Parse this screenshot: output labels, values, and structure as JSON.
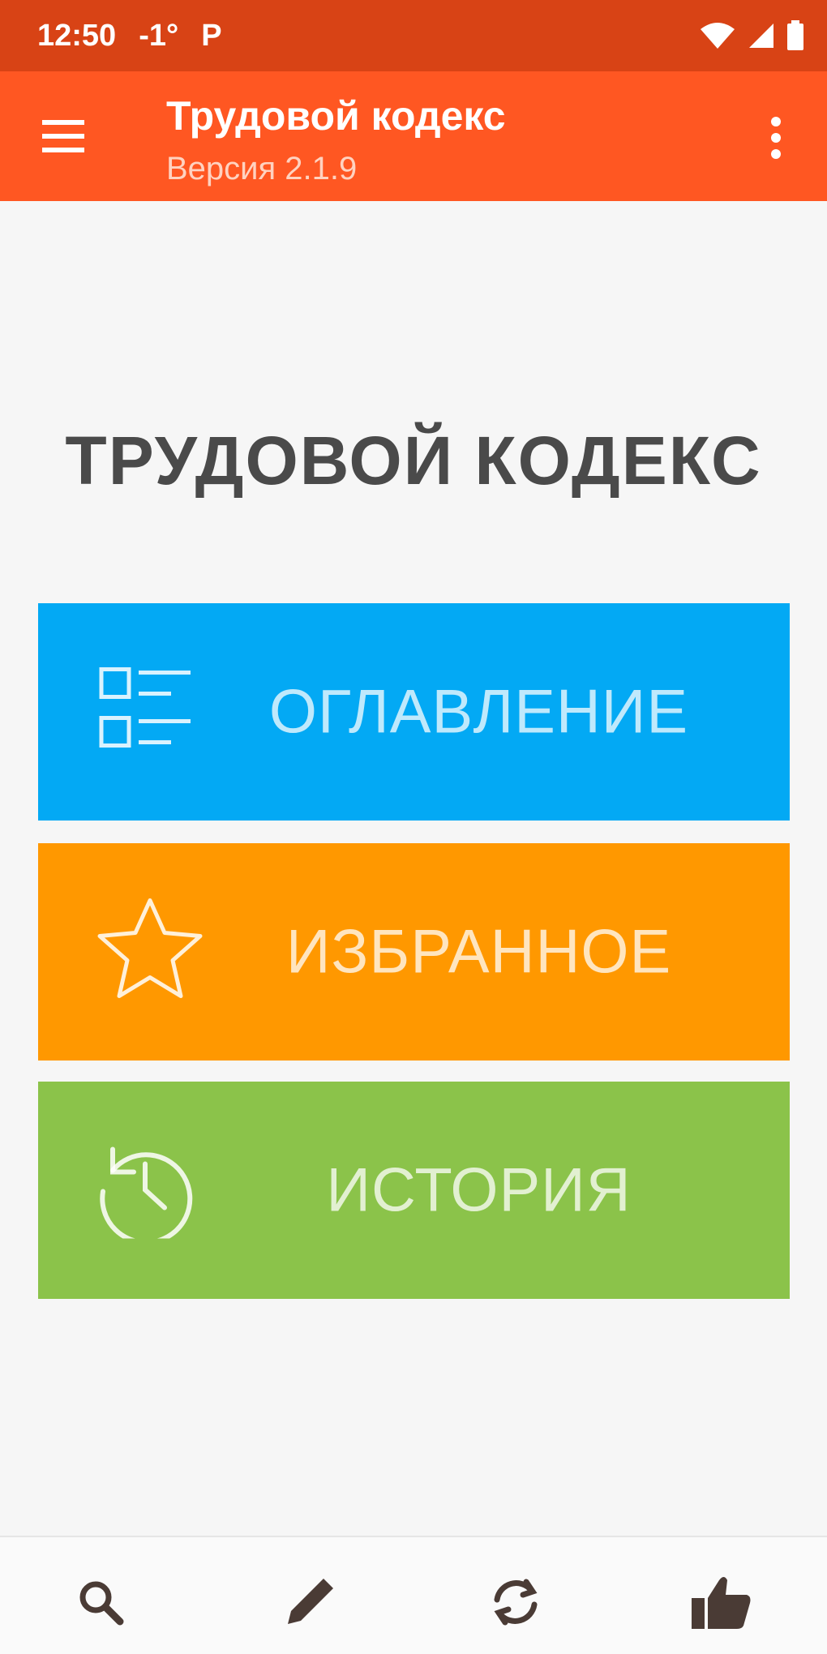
{
  "status_bar": {
    "time": "12:50",
    "temperature": "-1°",
    "notification": "P",
    "battery_label": "battery"
  },
  "app_bar": {
    "title": "Трудовой кодекс",
    "subtitle": "Версия 2.1.9",
    "menu_icon": "menu-icon",
    "overflow_icon": "more-vert-icon"
  },
  "main": {
    "heading": "ТРУДОВОЙ КОДЕКС",
    "tiles": [
      {
        "label": "ОГЛАВЛЕНИЕ",
        "icon": "list-icon",
        "color": "#03a9f4"
      },
      {
        "label": "ИЗБРАННОЕ",
        "icon": "star-icon",
        "color": "#ff9800"
      },
      {
        "label": "ИСТОРИЯ",
        "icon": "history-icon",
        "color": "#8bc34a"
      }
    ]
  },
  "bottom_bar": {
    "items": [
      {
        "icon": "search-icon"
      },
      {
        "icon": "pencil-icon"
      },
      {
        "icon": "sync-icon"
      },
      {
        "icon": "thumbs-up-icon"
      }
    ]
  },
  "colors": {
    "status_bar": "#d84315",
    "app_bar": "#ff5722",
    "background": "#f6f6f6"
  }
}
